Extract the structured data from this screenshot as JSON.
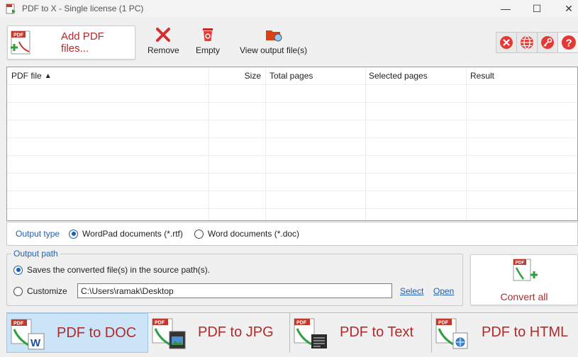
{
  "window": {
    "title": "PDF to X - Single license (1 PC)",
    "minimize_glyph": "—",
    "maximize_glyph": "☐",
    "close_glyph": "✕"
  },
  "toolbar": {
    "add_label": "Add PDF files...",
    "remove_label": "Remove",
    "empty_label": "Empty",
    "view_label": "View output file(s)",
    "right_icons": [
      "close-circle-icon",
      "globe-icon",
      "key-icon",
      "help-icon"
    ]
  },
  "table": {
    "columns": [
      "PDF file",
      "Size",
      "Total pages",
      "Selected pages",
      "Result"
    ],
    "sort_indicator": "▲",
    "rows": []
  },
  "output_type": {
    "label": "Output type",
    "options": [
      {
        "label": "WordPad documents (*.rtf)",
        "selected": true
      },
      {
        "label": "Word documents (*.doc)",
        "selected": false
      }
    ]
  },
  "output_path": {
    "legend": "Output path",
    "source_option": "Saves the converted file(s) in the source path(s).",
    "customize_option": "Customize",
    "path_value": "C:\\Users\\ramak\\Desktop",
    "select_link": "Select",
    "open_link": "Open"
  },
  "convert": {
    "label": "Convert all"
  },
  "tabs": [
    {
      "label": "PDF to DOC",
      "active": true
    },
    {
      "label": "PDF to JPG",
      "active": false
    },
    {
      "label": "PDF to Text",
      "active": false
    },
    {
      "label": "PDF to HTML",
      "active": false
    }
  ],
  "colors": {
    "accent_red": "#b22a2a",
    "link_blue": "#1a5fb4",
    "active_tab": "#cce4f7"
  }
}
